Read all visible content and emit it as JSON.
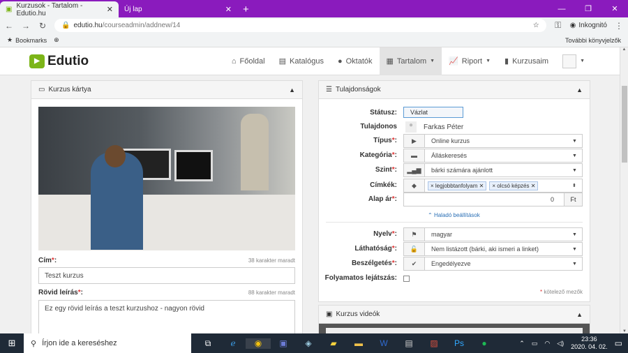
{
  "browser": {
    "tabs": [
      {
        "title": "Kurzusok - Tartalom - Edutio.hu"
      },
      {
        "title": "Új lap"
      }
    ],
    "url_host": "edutio.hu",
    "url_path": "/courseadmin/addnew/14",
    "profile": "Inkognitó",
    "bookmarks_label": "Bookmarks",
    "other_bookmarks": "További könyvjelzők"
  },
  "site": {
    "logo_text": "Edutio",
    "nav": [
      "Főoldal",
      "Katalógus",
      "Oktatók",
      "Tartalom",
      "Riport",
      "Kurzusaim"
    ]
  },
  "card_panel": {
    "title": "Kurzus kártya",
    "title_label": "Cím",
    "title_hint": "38 karakter maradt",
    "title_value": "Teszt kurzus",
    "short_label": "Rövid leírás",
    "short_hint": "88 karakter maradt",
    "short_value": "Ez egy rövid leírás a teszt kurzushoz - nagyon rövid"
  },
  "props_panel": {
    "title": "Tulajdonságok",
    "status_label": "Státusz:",
    "status_value": "Vázlat",
    "owner_label": "Tulajdonos",
    "owner_value": "Farkas Péter",
    "type_label": "Típus",
    "type_value": "Online kurzus",
    "category_label": "Kategória",
    "category_value": "Álláskeresés",
    "level_label": "Szint",
    "level_value": "bárki számára ajánlott",
    "tags_label": "Címkék:",
    "tags": [
      "legjobbtanfolyam",
      "olcsó képzés"
    ],
    "price_label": "Alap ár",
    "price_value": "0",
    "price_unit": "Ft",
    "advanced": "Haladó beállítások",
    "lang_label": "Nyelv",
    "lang_value": "magyar",
    "visibility_label": "Láthatóság",
    "visibility_value": "Nem listázott (bárki, aki ismeri a linket)",
    "discussion_label": "Beszélgetés",
    "discussion_value": "Engedélyezve",
    "autoplay_label": "Folyamatos lejátszás:",
    "required_note": "kötelező mezők"
  },
  "video_panel": {
    "title": "Kurzus videók"
  },
  "taskbar": {
    "search_placeholder": "Írjon ide a kereséshez",
    "time": "23:36",
    "date": "2020. 04. 02."
  }
}
